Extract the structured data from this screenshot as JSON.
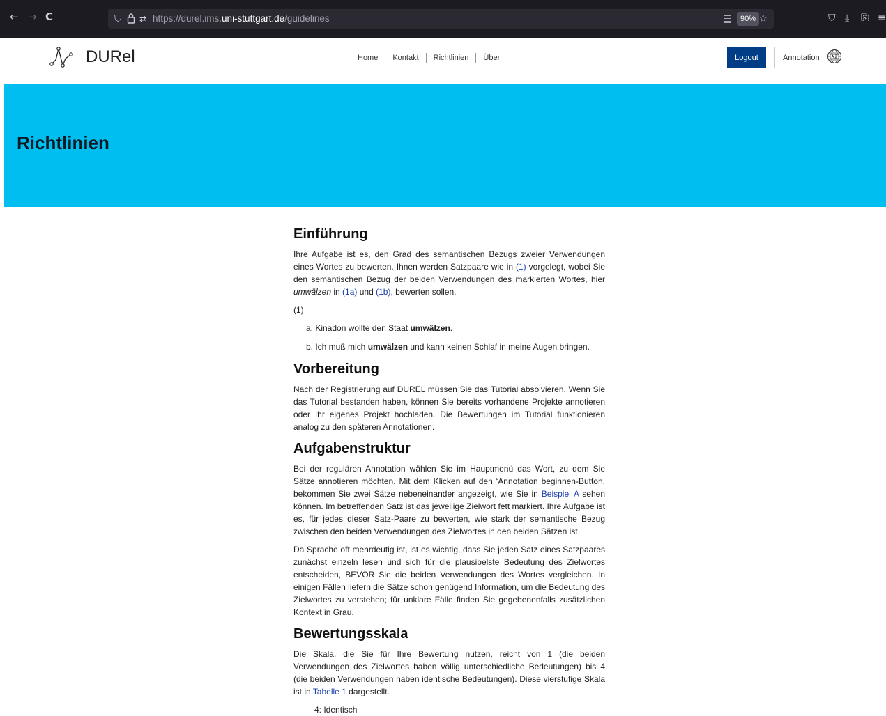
{
  "browser": {
    "back": "←",
    "forward": "→",
    "reload": "C",
    "url_prefix": "https://durel.ims.",
    "url_host": "uni-stuttgart.de",
    "url_path": "/guidelines",
    "zoom": "90%"
  },
  "header": {
    "brand": "DURel",
    "nav": [
      "Home",
      "Kontakt",
      "Richtlinien",
      "Über"
    ],
    "logout": "Logout",
    "annotation": "Annotation"
  },
  "hero": {
    "title": "Richtlinien"
  },
  "sections": {
    "intro": {
      "heading": "Einführung",
      "p1_a": "Ihre Aufgabe ist es, den Grad des semantischen Bezugs zweier Verwendungen eines Wortes zu bewerten. Ihnen werden Satzpaare wie in ",
      "p1_link1": "(1)",
      "p1_b": " vorgelegt, wobei Sie den semantischen Bezug der beiden Verwendungen des markierten Wortes, hier ",
      "p1_em": "umwälzen",
      "p1_c": " in ",
      "p1_link2": "(1a)",
      "p1_d": " und ",
      "p1_link3": "(1b)",
      "p1_e": ", bewerten sollen.",
      "example_label": "(1)",
      "ex_a_pre": "a. Kinadon wollte den Staat ",
      "ex_a_bold": "umwälzen",
      "ex_a_post": ".",
      "ex_b_pre": "b. Ich muß mich ",
      "ex_b_bold": "umwälzen",
      "ex_b_post": " und kann keinen Schlaf in meine Augen bringen."
    },
    "prep": {
      "heading": "Vorbereitung",
      "p1": "Nach der Registrierung auf DUREL müssen Sie das Tutorial absolvieren. Wenn Sie das Tutorial bestanden haben, können Sie bereits vorhandene Projekte annotieren oder Ihr eigenes Projekt hochladen. Die Bewertungen im Tutorial funktionieren analog zu den späteren Annotationen."
    },
    "task": {
      "heading": "Aufgabenstruktur",
      "p1_a": "Bei der regulären Annotation wählen Sie im Hauptmenü das Wort, zu dem Sie Sätze annotieren möchten. Mit dem Klicken auf den ‘Annotation beginnen-Button, bekommen Sie zwei Sätze nebeneinander angezeigt, wie Sie in ",
      "p1_link": "Beispiel A",
      "p1_b": " sehen können. Im betreffenden Satz ist das jeweilige Zielwort fett markiert. Ihre Aufgabe ist es, für jedes dieser Satz-Paare zu bewerten, wie stark der semantische Bezug zwischen den beiden Verwendungen des Zielwortes in den beiden Sätzen ist.",
      "p2": "Da Sprache oft mehrdeutig ist, ist es wichtig, dass Sie jeden Satz eines Satzpaares zunächst einzeln lesen und sich für die plausibelste Bedeutung des Zielwortes entscheiden, BEVOR Sie die beiden Verwendungen des Wortes vergleichen. In einigen Fällen liefern die Sätze schon genügend Information, um die Bedeutung des Zielwortes zu verstehen; für unklare Fälle finden Sie gegebenenfalls zusätzlichen Kontext in Grau."
    },
    "scale": {
      "heading": "Bewertungsskala",
      "p1_a": "Die Skala, die Sie für Ihre Bewertung nutzen, reicht von 1 (die beiden Verwendungen des Zielwortes haben völlig unterschiedliche Bedeutungen) bis 4 (die beiden Verwendungen haben identische Bedeutungen). Diese vierstufige Skala ist in ",
      "p1_link": "Tabelle 1",
      "p1_b": " dargestellt.",
      "list_first": "4: Identisch"
    }
  }
}
